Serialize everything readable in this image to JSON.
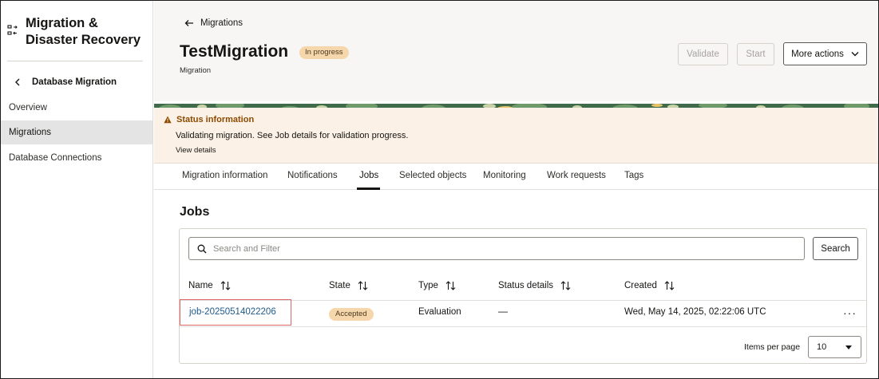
{
  "sidebar": {
    "app_title": "Migration & Disaster Recovery",
    "back_label": "Database Migration",
    "items": [
      {
        "label": "Overview",
        "active": false
      },
      {
        "label": "Migrations",
        "active": true
      },
      {
        "label": "Database Connections",
        "active": false
      }
    ]
  },
  "header": {
    "breadcrumb": "Migrations",
    "title": "TestMigration",
    "status_badge": "In progress",
    "subtitle": "Migration",
    "validate_label": "Validate",
    "start_label": "Start",
    "more_actions_label": "More actions"
  },
  "status_info": {
    "title": "Status information",
    "message": "Validating migration. See Job details for validation progress.",
    "link": "View details"
  },
  "tabs": [
    {
      "label": "Migration information"
    },
    {
      "label": "Notifications"
    },
    {
      "label": "Jobs",
      "active": true
    },
    {
      "label": "Selected objects"
    },
    {
      "label": "Monitoring"
    },
    {
      "label": "Work requests"
    },
    {
      "label": "Tags"
    }
  ],
  "jobs": {
    "heading": "Jobs",
    "search_placeholder": "Search and Filter",
    "search_button": "Search",
    "columns": [
      "Name",
      "State",
      "Type",
      "Status details",
      "Created"
    ],
    "rows": [
      {
        "name": "job-20250514022206",
        "state": "Accepted",
        "type": "Evaluation",
        "status_details": "—",
        "created": "Wed, May 14, 2025, 02:22:06 UTC",
        "actions": "···"
      }
    ],
    "items_per_page_label": "Items per page",
    "items_per_page": "10"
  },
  "colors": {
    "badge_bg": "#f5d7ab",
    "status_bg": "#fcf1e6",
    "warning": "#8c4a00",
    "link": "#1e5a8c",
    "highlight": "#e06666"
  }
}
